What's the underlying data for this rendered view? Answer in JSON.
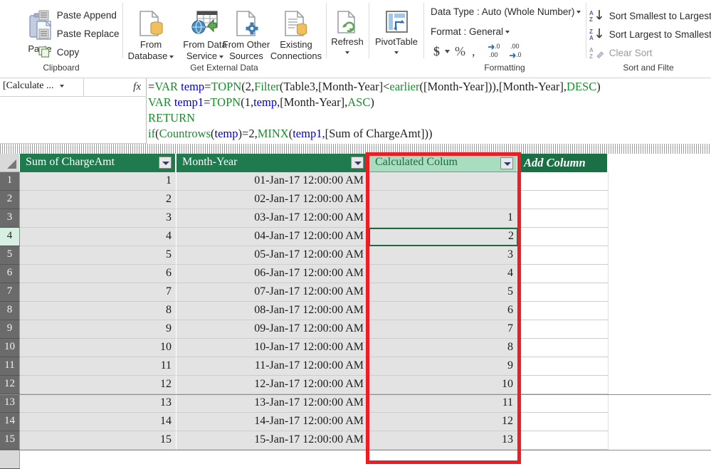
{
  "ribbon": {
    "groups": [
      {
        "label": "Clipboard"
      },
      {
        "label": "Get External Data"
      },
      {
        "label": "Formatting"
      },
      {
        "label": "Sort and Filte"
      }
    ],
    "clipboard": {
      "paste_label": "Paste",
      "paste_icon": "clipboard-paste-icon",
      "paste_append": "Paste Append",
      "paste_append_icon": "paste-append-icon",
      "paste_replace": "Paste Replace",
      "paste_replace_icon": "paste-replace-icon",
      "copy": "Copy",
      "copy_icon": "copy-icon"
    },
    "get_external_data": {
      "from_database_l1": "From",
      "from_database_l2": "Database",
      "from_database_icon": "database-page-icon",
      "from_data_service_l1": "From Data",
      "from_data_service_l2": "Service",
      "from_data_service_icon": "data-service-globe-icon",
      "from_other_sources_l1": "From Other",
      "from_other_sources_l2": "Sources",
      "from_other_sources_icon": "other-sources-icon",
      "existing_connections_l1": "Existing",
      "existing_connections_l2": "Connections",
      "existing_connections_icon": "existing-connections-icon"
    },
    "refresh": {
      "label": "Refresh",
      "icon": "refresh-page-icon"
    },
    "pivot": {
      "label": "PivotTable",
      "icon": "pivottable-icon"
    },
    "formatting": {
      "data_type": "Data Type : Auto (Whole Number)",
      "format": "Format : General",
      "currency_icon": "currency-dollar-icon",
      "percent_icon": "percent-icon",
      "comma_icon": "comma-style-icon",
      "increase_decimal_icon": "increase-decimal-icon",
      "decrease_decimal_icon": "decrease-decimal-icon"
    },
    "sort_and_filter": {
      "sort_small_large": "Sort Smallest to Largest",
      "sort_small_large_icon": "sort-ascending-icon",
      "sort_large_small": "Sort Largest to Smallest",
      "sort_large_small_icon": "sort-descending-icon",
      "clear_sort": "Clear Sort",
      "clear_sort_icon": "clear-sort-icon"
    }
  },
  "formula_bar": {
    "name_box": "[Calculate ...",
    "fx_label": "fx",
    "formula_lines": [
      "=VAR temp=TOPN(2,Filter(Table3,[Month-Year]<earlier([Month-Year])),[Month-Year],DESC)",
      "VAR temp1=TOPN(1,temp,[Month-Year],ASC)",
      "RETURN",
      "if(Countrows(temp)=2,MINX(temp1,[Sum of ChargeAmt]))"
    ],
    "formula_full": "=VAR temp=TOPN(2,Filter(Table3,[Month-Year]<earlier([Month-Year])),[Month-Year],DESC)\nVAR temp1=TOPN(1,temp,[Month-Year],ASC)\nRETURN\nif(Countrows(temp)=2,MINX(temp1,[Sum of ChargeAmt]))"
  },
  "grid": {
    "columns": [
      {
        "name": "Sum of ChargeAmt",
        "filter": true,
        "state": "normal"
      },
      {
        "name": "Month-Year",
        "filter": true,
        "state": "normal"
      },
      {
        "name": "Calculated Colum",
        "filter": true,
        "state": "selected"
      },
      {
        "name": "Add Column",
        "filter": false,
        "state": "addcolumn"
      }
    ],
    "selected_cell": {
      "row": 4,
      "column": "Calculated Colum",
      "value": "2"
    },
    "rows": [
      {
        "num": "1",
        "charge": "1",
        "month_year": "01-Jan-17 12:00:00 AM",
        "calc": ""
      },
      {
        "num": "2",
        "charge": "2",
        "month_year": "02-Jan-17 12:00:00 AM",
        "calc": ""
      },
      {
        "num": "3",
        "charge": "3",
        "month_year": "03-Jan-17 12:00:00 AM",
        "calc": "1"
      },
      {
        "num": "4",
        "charge": "4",
        "month_year": "04-Jan-17 12:00:00 AM",
        "calc": "2"
      },
      {
        "num": "5",
        "charge": "5",
        "month_year": "05-Jan-17 12:00:00 AM",
        "calc": "3"
      },
      {
        "num": "6",
        "charge": "6",
        "month_year": "06-Jan-17 12:00:00 AM",
        "calc": "4"
      },
      {
        "num": "7",
        "charge": "7",
        "month_year": "07-Jan-17 12:00:00 AM",
        "calc": "5"
      },
      {
        "num": "8",
        "charge": "8",
        "month_year": "08-Jan-17 12:00:00 AM",
        "calc": "6"
      },
      {
        "num": "9",
        "charge": "9",
        "month_year": "09-Jan-17 12:00:00 AM",
        "calc": "7"
      },
      {
        "num": "10",
        "charge": "10",
        "month_year": "10-Jan-17 12:00:00 AM",
        "calc": "8"
      },
      {
        "num": "11",
        "charge": "11",
        "month_year": "11-Jan-17 12:00:00 AM",
        "calc": "9"
      },
      {
        "num": "12",
        "charge": "12",
        "month_year": "12-Jan-17 12:00:00 AM",
        "calc": "10"
      },
      {
        "num": "13",
        "charge": "13",
        "month_year": "13-Jan-17 12:00:00 AM",
        "calc": "11"
      },
      {
        "num": "14",
        "charge": "14",
        "month_year": "14-Jan-17 12:00:00 AM",
        "calc": "12"
      },
      {
        "num": "15",
        "charge": "15",
        "month_year": "15-Jan-17 12:00:00 AM",
        "calc": "13"
      }
    ]
  },
  "annotation": {
    "type": "red-rectangle-highlight",
    "target_column": "Calculated Colum",
    "color": "#ee1c25"
  },
  "colors": {
    "header_green": "#1f7a4d",
    "selected_header_green": "#a8ddbf",
    "add_column_green": "#1a6f45",
    "cell_fill": "#e3e3e3",
    "row_header": "#6b6b6b",
    "annotation_red": "#ee1c25",
    "formula_function": "#1a8c2e",
    "formula_variable": "#0000d0"
  }
}
